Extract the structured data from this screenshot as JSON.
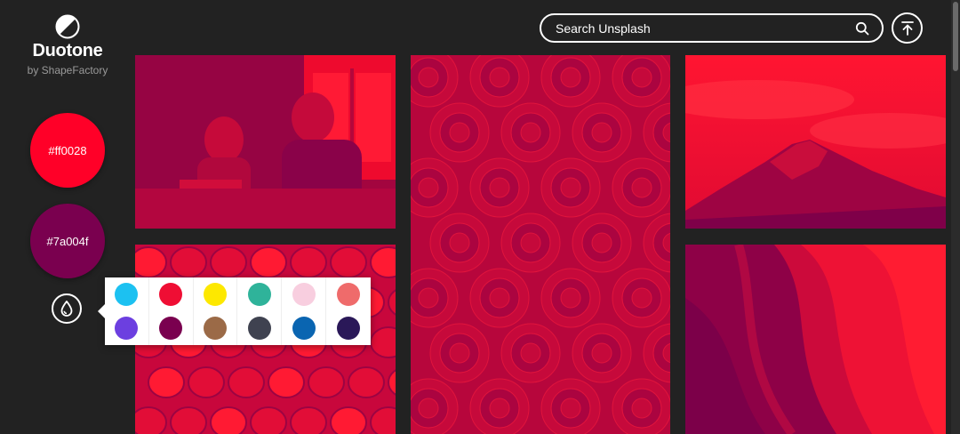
{
  "brand": {
    "title": "Duotone",
    "subtitle": "by ShapeFactory",
    "logo_icon": "half-circle-icon"
  },
  "colors": {
    "highlight": "#ff0028",
    "shadow": "#7a004f",
    "highlight_label": "#ff0028",
    "shadow_label": "#7a004f"
  },
  "palette_button_icon": "drop-icon",
  "palette": [
    "#1cc1f1",
    "#ef0e34",
    "#fde800",
    "#2fb39a",
    "#f8cedf",
    "#ef6b6b",
    "#6c3fe0",
    "#7a004f",
    "#9b6a47",
    "#3f4250",
    "#0a65b1",
    "#2a1858"
  ],
  "search": {
    "placeholder": "Search Unsplash",
    "icon": "search-icon"
  },
  "scroll_top_icon": "arrow-up-to-line-icon",
  "photos": [
    {
      "subject": "people-cafe"
    },
    {
      "subject": "succulents"
    },
    {
      "subject": "mountain-peak"
    },
    {
      "subject": "flowers"
    },
    {
      "subject": "canyon"
    }
  ]
}
